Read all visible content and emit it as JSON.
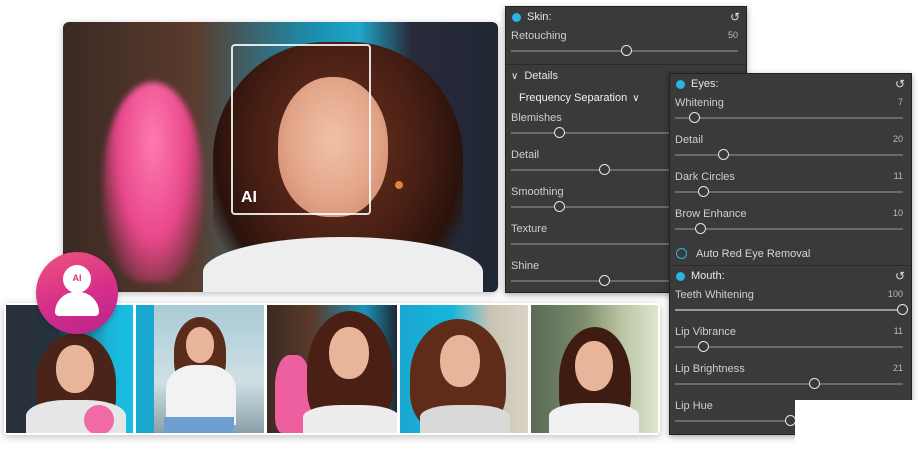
{
  "hero": {
    "ai_label": "AI"
  },
  "badge": {
    "label": "AI"
  },
  "skin": {
    "title": "Skin:",
    "sliders": [
      {
        "label": "Retouching",
        "value": "50",
        "level": 0.5
      }
    ],
    "details_label": "Details",
    "dropdown_label": "Frequency Separation",
    "detail_sliders": [
      {
        "label": "Blemishes",
        "value": "",
        "level": 0.29
      },
      {
        "label": "Detail",
        "value": "",
        "level": 0.59
      },
      {
        "label": "Smoothing",
        "value": "",
        "level": 0.29
      },
      {
        "label": "Texture",
        "value": "",
        "level": null
      },
      {
        "label": "Shine",
        "value": "",
        "level": 0.59
      }
    ]
  },
  "eyes": {
    "title": "Eyes:",
    "sliders": [
      {
        "label": "Whitening",
        "value": "7",
        "level": 0.07
      },
      {
        "label": "Detail",
        "value": "20",
        "level": 0.2
      },
      {
        "label": "Dark Circles",
        "value": "11",
        "level": 0.11
      },
      {
        "label": "Brow Enhance",
        "value": "10",
        "level": 0.1
      }
    ],
    "checkbox_label": "Auto Red Eye Removal"
  },
  "mouth": {
    "title": "Mouth:",
    "sliders": [
      {
        "label": "Teeth Whitening",
        "value": "100",
        "level": 1.0
      },
      {
        "label": "Lip Vibrance",
        "value": "11",
        "level": 0.11
      },
      {
        "label": "Lip Brightness",
        "value": "21",
        "level": 0.61
      },
      {
        "label": "Lip Hue",
        "value": "",
        "level": 0.5
      }
    ]
  },
  "colors": {
    "accent": "#2bb4e6",
    "panel_bg": "#3a3a3a",
    "badge_pink": "#d42e8a"
  },
  "icons": [
    "reset-icon",
    "chevron-down-icon",
    "user-icon"
  ]
}
